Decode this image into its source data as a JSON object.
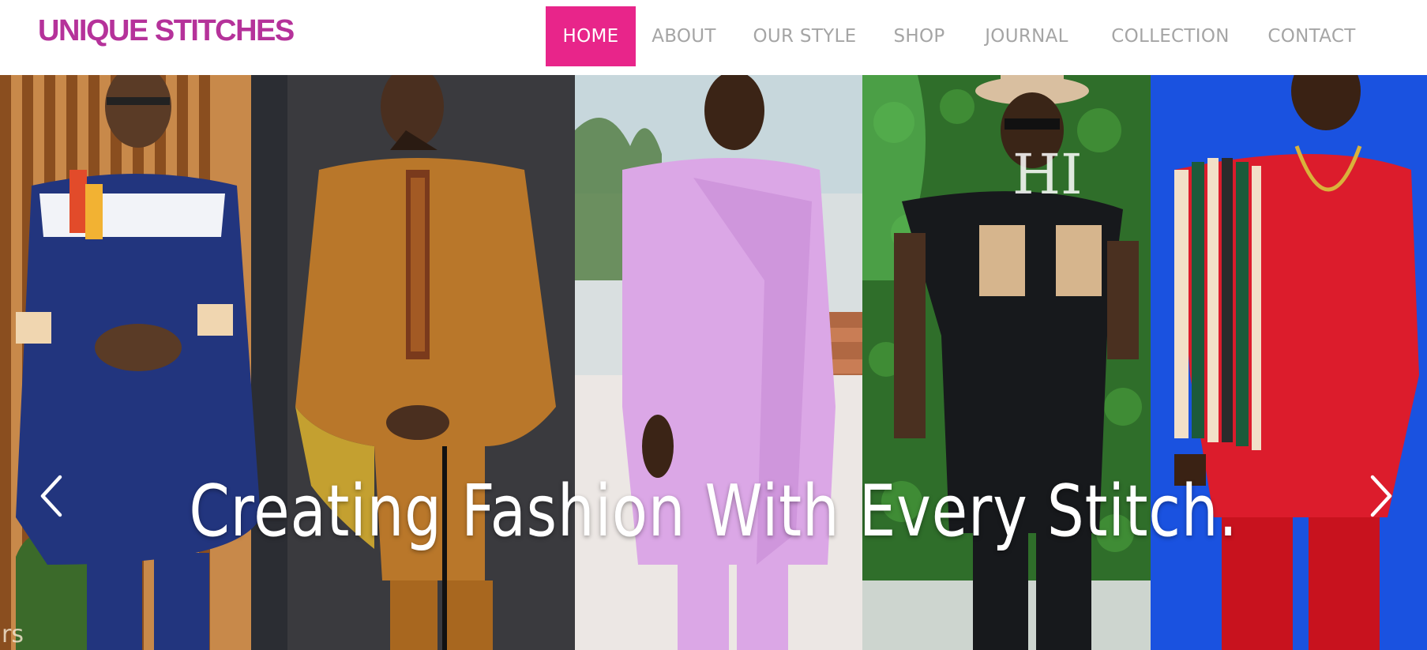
{
  "brand": {
    "name": "UNIQUE STITCHES",
    "color": "#b5329a"
  },
  "nav": {
    "items": [
      {
        "label": "HOME",
        "active": true
      },
      {
        "label": "ABOUT",
        "active": false
      },
      {
        "label": "OUR STYLE",
        "active": false
      },
      {
        "label": "SHOP",
        "active": false
      },
      {
        "label": "JOURNAL",
        "active": false
      },
      {
        "label": "COLLECTION",
        "active": false
      },
      {
        "label": "CONTACT",
        "active": false
      }
    ],
    "active_color": "#e8258a"
  },
  "hero": {
    "caption": "Creating Fashion With Every Stitch.",
    "prev_icon": "chevron-left-icon",
    "next_icon": "chevron-right-icon",
    "watermark": "rs",
    "panels": [
      {
        "name": "model-navy-outfit",
        "outfit_color": "#22357e"
      },
      {
        "name": "model-mustard-agbada",
        "outfit_color": "#b9772a"
      },
      {
        "name": "model-lilac-kaftan",
        "outfit_color": "#dba7e6"
      },
      {
        "name": "model-black-shirt-hat",
        "outfit_color": "#17191c"
      },
      {
        "name": "model-red-striped-outfit",
        "outfit_color": "#dc1c2c"
      }
    ]
  }
}
